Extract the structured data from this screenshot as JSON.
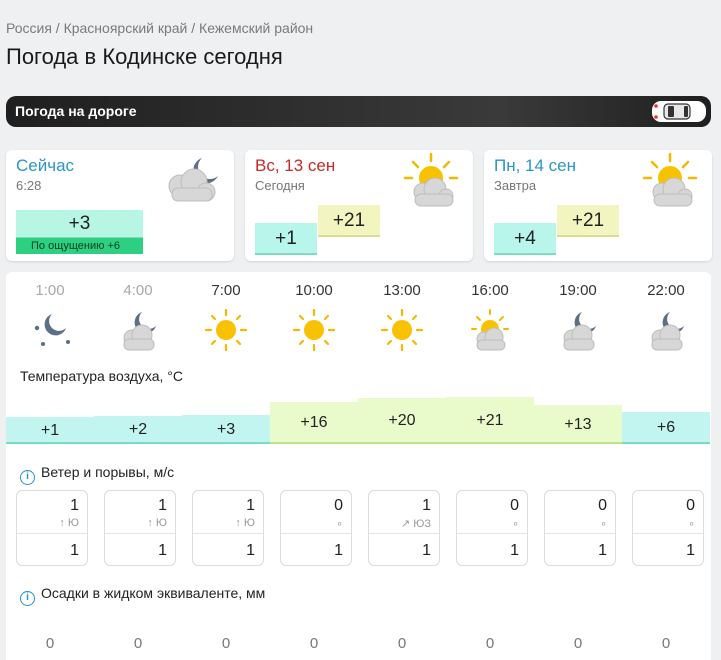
{
  "breadcrumb": "Россия / Красноярский край / Кежемский район",
  "page_title": "Погода в Кодинске сегодня",
  "road": {
    "label": "Погода на дороге"
  },
  "now": {
    "title": "Сейчас",
    "time": "6:28",
    "temp": "+3",
    "feels": "По ощущению  +6",
    "icon": "cloud-moon-icon"
  },
  "today": {
    "title": "Вс, 13 сен",
    "sub": "Сегодня",
    "min": "+1",
    "max": "+21",
    "icon": "sun-cloud-icon"
  },
  "tomorrow": {
    "title": "Пн, 14 сен",
    "sub": "Завтра",
    "min": "+4",
    "max": "+21",
    "icon": "sun-cloud-icon"
  },
  "forecast": {
    "temp_title": "Температура воздуха, °C",
    "wind_title": "Ветер и порывы, м/с",
    "precip_title": "Осадки в жидком эквиваленте, мм",
    "hours": [
      {
        "time": "1:00",
        "icon": "moon-stars-icon",
        "temp": "+1",
        "temp_value": 1,
        "wind": "1",
        "dir": "↑ Ю",
        "gust": "1",
        "precip": "0",
        "past": true
      },
      {
        "time": "4:00",
        "icon": "moon-cloud-icon",
        "temp": "+2",
        "temp_value": 2,
        "wind": "1",
        "dir": "↑ Ю",
        "gust": "1",
        "precip": "0",
        "past": true
      },
      {
        "time": "7:00",
        "icon": "sun-icon",
        "temp": "+3",
        "temp_value": 3,
        "wind": "1",
        "dir": "↑ Ю",
        "gust": "1",
        "precip": "0",
        "past": false
      },
      {
        "time": "10:00",
        "icon": "sun-icon",
        "temp": "+16",
        "temp_value": 16,
        "wind": "0",
        "dir": "∘",
        "gust": "1",
        "precip": "0",
        "past": false
      },
      {
        "time": "13:00",
        "icon": "sun-icon",
        "temp": "+20",
        "temp_value": 20,
        "wind": "1",
        "dir": "↗ ЮЗ",
        "gust": "1",
        "precip": "0",
        "past": false
      },
      {
        "time": "16:00",
        "icon": "sun-cloud-icon",
        "temp": "+21",
        "temp_value": 21,
        "wind": "0",
        "dir": "∘",
        "gust": "1",
        "precip": "0",
        "past": false
      },
      {
        "time": "19:00",
        "icon": "moon-cloud-icon",
        "temp": "+13",
        "temp_value": 13,
        "wind": "0",
        "dir": "∘",
        "gust": "1",
        "precip": "0",
        "past": false
      },
      {
        "time": "22:00",
        "icon": "moon-cloud-icon",
        "temp": "+6",
        "temp_value": 6,
        "wind": "0",
        "dir": "∘",
        "gust": "1",
        "precip": "0",
        "past": false
      }
    ]
  },
  "colors": {
    "cold": "#b8f6ec",
    "warm": "#e5f9c8",
    "warm2": "#f3f5c0",
    "accent": "#2a96c9",
    "today": "#c72a2a"
  }
}
